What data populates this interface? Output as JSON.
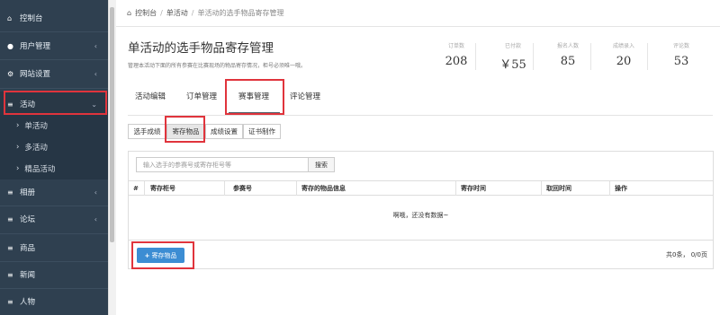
{
  "sidebar": {
    "items": [
      {
        "icon": "dashboard-icon",
        "label": "控制台",
        "chevron": ""
      },
      {
        "icon": "users-icon",
        "label": "用户管理",
        "chevron": "‹"
      },
      {
        "icon": "cogs-icon",
        "label": "网站设置",
        "chevron": "‹"
      },
      {
        "icon": "list-icon",
        "label": "活动",
        "chevron": "⌄"
      },
      {
        "icon": "list-icon",
        "label": "相册",
        "chevron": "‹"
      },
      {
        "icon": "list-icon",
        "label": "论坛",
        "chevron": "‹"
      },
      {
        "icon": "list-icon",
        "label": "商品",
        "chevron": ""
      },
      {
        "icon": "list-icon",
        "label": "新闻",
        "chevron": ""
      },
      {
        "icon": "list-icon",
        "label": "人物",
        "chevron": ""
      }
    ],
    "sub_items": [
      {
        "label": "单活动"
      },
      {
        "label": "多活动"
      },
      {
        "label": "精品活动"
      }
    ]
  },
  "breadcrumb": {
    "home_icon": "home-icon",
    "items": [
      "控制台",
      "单活动",
      "单活动的选手物品寄存管理"
    ]
  },
  "page": {
    "title": "单活动的选手物品寄存管理",
    "description": "管理本活动下面的所有参赛在比赛现场的物品寄存情况，柜号必须唯一哦。"
  },
  "stats": [
    {
      "label": "订单数",
      "value": "208"
    },
    {
      "label": "已付款",
      "value": "￥55"
    },
    {
      "label": "报名人数",
      "value": "85"
    },
    {
      "label": "成绩录入",
      "value": "20"
    },
    {
      "label": "评论数",
      "value": "53"
    }
  ],
  "tabs": [
    {
      "label": "活动编辑"
    },
    {
      "label": "订单管理"
    },
    {
      "label": "赛事管理",
      "active": true
    },
    {
      "label": "评论管理"
    }
  ],
  "subtabs": [
    {
      "label": "选手成绩"
    },
    {
      "label": "寄存物品",
      "active": true
    },
    {
      "label": "成绩设置"
    },
    {
      "label": "证书制作"
    }
  ],
  "search": {
    "placeholder": "输入选手的参赛号或寄存柜号等",
    "button": "搜索"
  },
  "table": {
    "columns": [
      "#",
      "寄存柜号",
      "参赛号",
      "寄存的物品信息",
      "寄存时间",
      "取回时间",
      "操作"
    ],
    "empty_text": "啊哦，还没有数据~"
  },
  "footer": {
    "add_button": "寄存物品",
    "add_icon": "plus-icon",
    "pager": "共0条， 0/0页"
  },
  "colors": {
    "sidebar_bg": "#2f4050",
    "primary": "#3c8dd3",
    "highlight": "#e0343c"
  }
}
